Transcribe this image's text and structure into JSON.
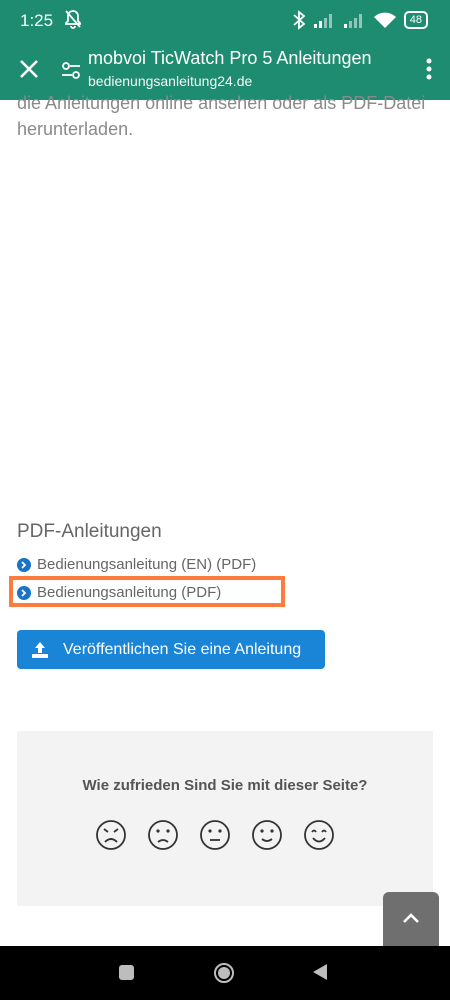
{
  "status": {
    "time": "1:25",
    "battery": "48"
  },
  "appbar": {
    "title": "mobvoi TicWatch Pro 5 Anleitungen",
    "url": "bedienungsanleitung24.de"
  },
  "content": {
    "intro_text": "die Anleitungen online ansehen oder als PDF-Datei herunterladen.",
    "section_title": "PDF-Anleitungen",
    "links": [
      {
        "label": "Bedienungsanleitung (EN) (PDF)"
      },
      {
        "label": "Bedienungsanleitung (PDF)"
      }
    ],
    "publish_button": "Veröffentlichen Sie eine Anleitung"
  },
  "feedback": {
    "question": "Wie zufrieden Sind Sie mit dieser Seite?",
    "faces": [
      "very-sad-face-icon",
      "sad-face-icon",
      "neutral-face-icon",
      "happy-face-icon",
      "very-happy-face-icon"
    ]
  },
  "colors": {
    "brand": "#1e8c70",
    "link_bullet": "#1a73c7",
    "button": "#1a85d6",
    "highlight": "#ff7a3d"
  }
}
